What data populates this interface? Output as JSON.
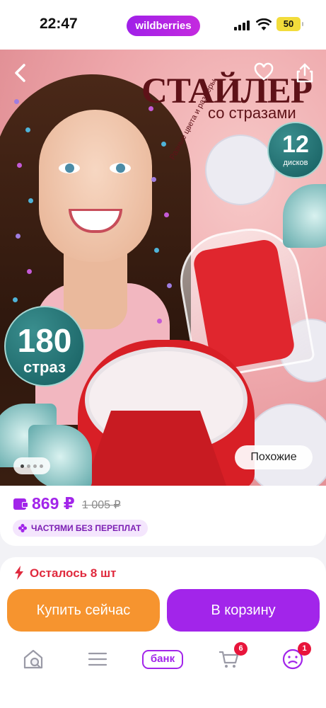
{
  "status_bar": {
    "time": "22:47",
    "brand": "wildberries",
    "battery": "50",
    "icons": [
      "signal-icon",
      "wifi-icon",
      "battery-icon"
    ]
  },
  "product_image": {
    "headline": "СТАЙЛЕР",
    "subheadline": "со стразами",
    "curved_caption": "Разные цвета и размеры",
    "disks_count": "12",
    "disks_label": "дисков",
    "stones_count": "180",
    "stones_label": "страз",
    "similar_label": "Похожие",
    "gallery_dots": 4,
    "active_dot": 0
  },
  "price": {
    "current": "869 ₽",
    "old": "1 005 ₽",
    "installment": "ЧАСТЯМИ БЕЗ ПЕРЕПЛАТ"
  },
  "stock": {
    "text": "Осталось 8 шт"
  },
  "actions": {
    "buy_now": "Купить сейчас",
    "add_to_cart": "В корзину"
  },
  "tab_bar": {
    "bank_label": "банк",
    "cart_badge": "6",
    "profile_badge": "1"
  },
  "colors": {
    "brand_purple": "#a225ea",
    "buy_now_orange": "#f6942f",
    "stock_red": "#e02a3e",
    "badge_red": "#e8153b"
  }
}
